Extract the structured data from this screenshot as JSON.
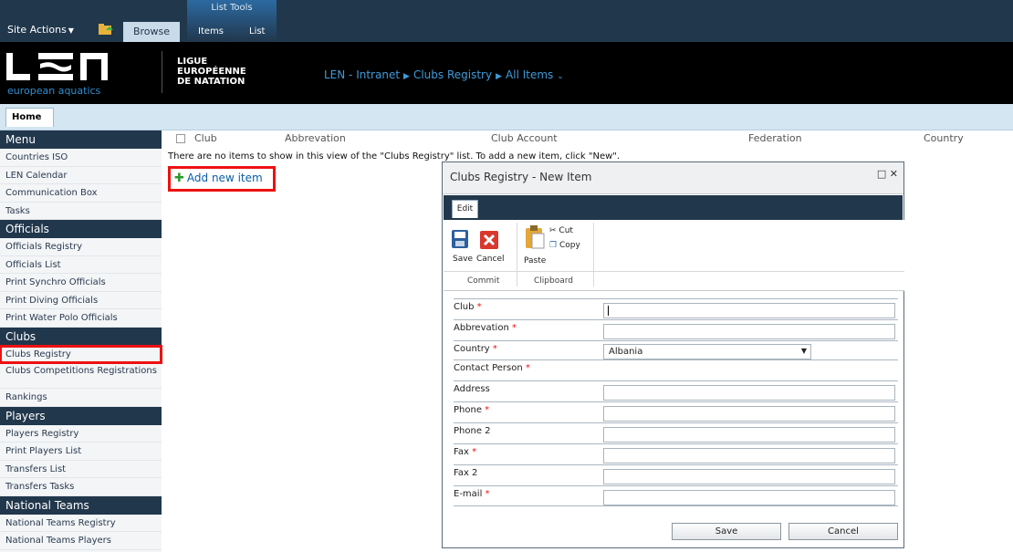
{
  "ribbon": {
    "site_actions": "Site Actions",
    "browse_tab": "Browse",
    "list_tools_title": "List Tools",
    "list_tools_items": "Items",
    "list_tools_list": "List"
  },
  "header": {
    "logo_text": "LEN",
    "logo_sub": "european aquatics",
    "ligue_line1": "LIGUE",
    "ligue_line2": "EUROPÉENNE",
    "ligue_line3": "DE NATATION",
    "breadcrumb": [
      "LEN - Intranet",
      "Clubs Registry",
      "All Items"
    ]
  },
  "topnav": {
    "home": "Home"
  },
  "sidebar": {
    "sections": [
      {
        "title": "Menu",
        "items": [
          "Countries ISO",
          "LEN Calendar",
          "Communication Box",
          "Tasks"
        ]
      },
      {
        "title": "Officials",
        "items": [
          "Officials Registry",
          "Officials List",
          "Print Synchro Officials",
          "Print Diving Officials",
          "Print Water Polo Officials"
        ]
      },
      {
        "title": "Clubs",
        "items": [
          "Clubs Registry",
          "Clubs Competitions Registrations",
          "Rankings"
        ]
      },
      {
        "title": "Players",
        "items": [
          "Players Registry",
          "Print Players List",
          "Transfers List",
          "Transfers Tasks"
        ]
      },
      {
        "title": "National Teams",
        "items": [
          "National Teams Registry",
          "National Teams Players"
        ]
      }
    ]
  },
  "list": {
    "columns": [
      "Club",
      "Abbrevation",
      "Club Account",
      "Federation",
      "Country"
    ],
    "empty_message": "There are no items to show in this view of the \"Clubs Registry\" list. To add a new item, click \"New\".",
    "add_new": "Add new item"
  },
  "dialog": {
    "title": "Clubs Registry - New Item",
    "edit_tab": "Edit",
    "save": "Save",
    "cancel": "Cancel",
    "paste": "Paste",
    "cut": "Cut",
    "copy": "Copy",
    "commit_group": "Commit",
    "clipboard_group": "Clipboard",
    "fields": [
      {
        "label": "Club",
        "required": true,
        "type": "text",
        "value": ""
      },
      {
        "label": "Abbrevation",
        "required": true,
        "type": "text",
        "value": ""
      },
      {
        "label": "Country",
        "required": true,
        "type": "select",
        "value": "Albania"
      },
      {
        "label": "Contact Person",
        "required": true,
        "type": "none",
        "value": ""
      },
      {
        "label": "Address",
        "required": false,
        "type": "text",
        "value": ""
      },
      {
        "label": "Phone",
        "required": true,
        "type": "text",
        "value": ""
      },
      {
        "label": "Phone 2",
        "required": false,
        "type": "text",
        "value": ""
      },
      {
        "label": "Fax",
        "required": true,
        "type": "text",
        "value": ""
      },
      {
        "label": "Fax 2",
        "required": false,
        "type": "text",
        "value": ""
      },
      {
        "label": "E-mail",
        "required": true,
        "type": "text",
        "value": ""
      }
    ],
    "save_button": "Save",
    "cancel_button": "Cancel"
  },
  "colors": {
    "ribbon": "#21374c",
    "accent_blue": "#3f9bd9",
    "highlight_red": "#ee1111"
  }
}
